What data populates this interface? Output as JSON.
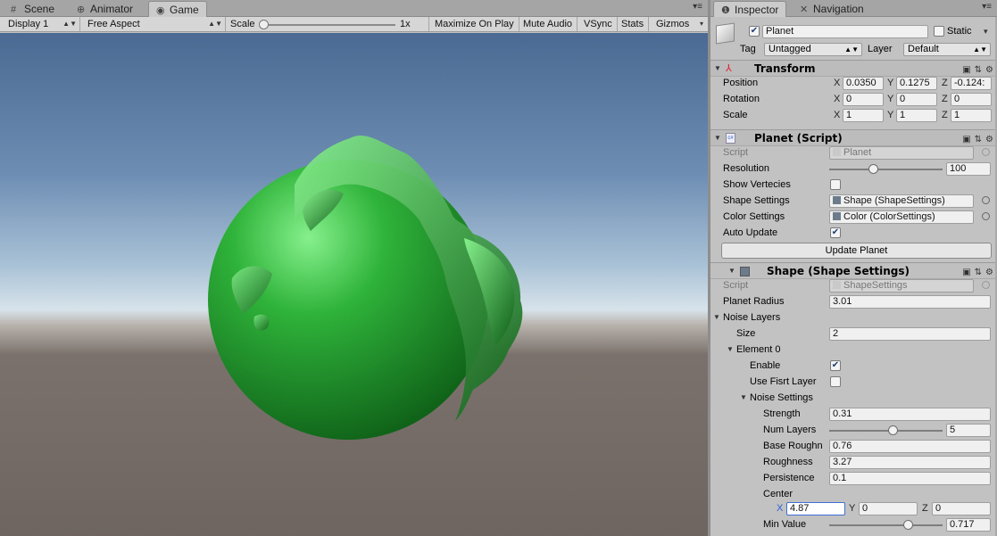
{
  "window_tabs": {
    "scene": "Scene",
    "animator": "Animator",
    "game": "Game",
    "inspector": "Inspector",
    "navigation": "Navigation"
  },
  "game_toolbar": {
    "display": "Display 1",
    "aspect": "Free Aspect",
    "scale_label": "Scale",
    "scale_value": "1x",
    "maximize": "Maximize On Play",
    "mute": "Mute Audio",
    "vsync": "VSync",
    "stats": "Stats",
    "gizmos": "Gizmos"
  },
  "colors": {
    "planet": "#2fb33a",
    "planet_highlight": "#86f08c",
    "planet_shadow": "#0e5e17"
  },
  "object": {
    "name": "Planet",
    "active": true,
    "static_label": "Static",
    "static": false,
    "tag_label": "Tag",
    "tag": "Untagged",
    "layer_label": "Layer",
    "layer": "Default"
  },
  "transform": {
    "title": "Transform",
    "position_label": "Position",
    "rotation_label": "Rotation",
    "scale_label": "Scale",
    "pos_x": "0.0350",
    "pos_y": "0.1275",
    "pos_z": "-0.124:",
    "rot_x": "0",
    "rot_y": "0",
    "rot_z": "0",
    "scl_x": "1",
    "scl_y": "1",
    "scl_z": "1"
  },
  "planet_script": {
    "title": "Planet (Script)",
    "script_label": "Script",
    "script_value": "Planet",
    "resolution_label": "Resolution",
    "resolution": "100",
    "resolution_fraction": 0.39,
    "show_vertecies_label": "Show Vertecies",
    "show_vertecies": false,
    "shape_settings_label": "Shape Settings",
    "shape_settings": "Shape (ShapeSettings)",
    "color_settings_label": "Color Settings",
    "color_settings": "Color (ColorSettings)",
    "auto_update_label": "Auto Update",
    "auto_update": true,
    "update_button": "Update Planet"
  },
  "shape": {
    "title": "Shape (Shape Settings)",
    "script_label": "Script",
    "script_value": "ShapeSettings",
    "planet_radius_label": "Planet Radius",
    "planet_radius": "3.01",
    "noise_layers_label": "Noise Layers",
    "size_label": "Size",
    "size": "2",
    "element0_label": "Element 0",
    "enable_label": "Enable",
    "enable": true,
    "use_first_layer_label": "Use Fisrt Layer",
    "use_first_layer": false,
    "noise_settings_label": "Noise Settings",
    "strength_label": "Strength",
    "strength": "0.31",
    "num_layers_label": "Num Layers",
    "num_layers": "5",
    "num_layers_fraction": 0.57,
    "base_roughness_label": "Base Roughn",
    "base_roughness": "0.76",
    "roughness_label": "Roughness",
    "roughness": "3.27",
    "persistence_label": "Persistence",
    "persistence": "0.1",
    "center_label": "Center",
    "center_x": "4.87",
    "center_y": "0",
    "center_z": "0",
    "min_value_label": "Min Value",
    "min_value": "0.717",
    "min_value_fraction": 0.7
  },
  "axes": {
    "x": "X",
    "y": "Y",
    "z": "Z"
  }
}
